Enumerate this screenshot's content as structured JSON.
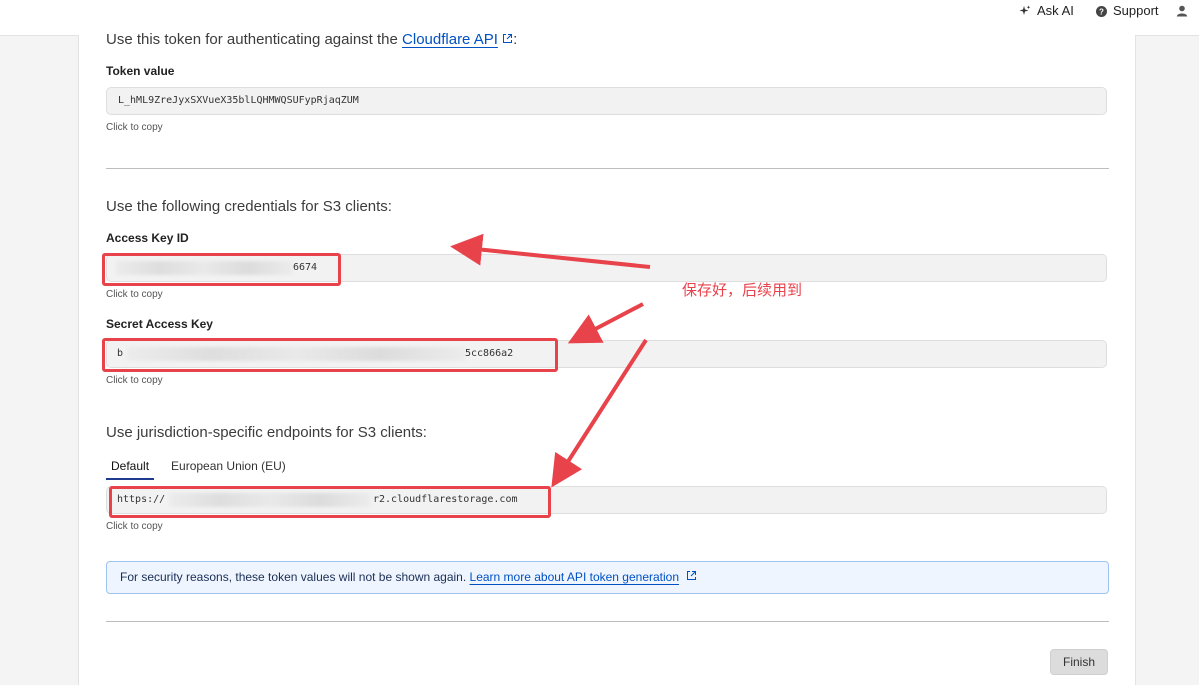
{
  "topbar": {
    "ask_ai_label": "Ask AI",
    "support_label": "Support"
  },
  "token_section": {
    "intro_text": "Use this token for authenticating against the",
    "api_link_text": "Cloudflare API",
    "intro_suffix": ":",
    "token_label": "Token value",
    "token_value": "L_hML9ZreJyxSXVueX35blLQHMWQSUFypRjaqZUM",
    "click_to_copy": "Click to copy"
  },
  "s3_section": {
    "intro_text": "Use the following credentials for S3 clients:",
    "access_key_label": "Access Key ID",
    "access_key_visible_suffix": "6674",
    "secret_key_label": "Secret Access Key",
    "secret_key_visible_prefix": "b",
    "secret_key_visible_suffix": "5cc866a2",
    "click_to_copy": "Click to copy"
  },
  "endpoint_section": {
    "intro_text": "Use jurisdiction-specific endpoints for S3 clients:",
    "tabs": [
      {
        "label": "Default",
        "active": true
      },
      {
        "label": "European Union (EU)",
        "active": false
      }
    ],
    "endpoint_prefix": "https://",
    "endpoint_suffix": "r2.cloudflarestorage.com",
    "click_to_copy": "Click to copy"
  },
  "notice": {
    "text": "For security reasons, these token values will not be shown again.",
    "link_text": "Learn more about API token generation"
  },
  "footer": {
    "finish_label": "Finish"
  },
  "annotation": {
    "text": "保存好，后续用到"
  },
  "colors": {
    "annotation_red": "#e8424b",
    "link_blue": "#0051c3",
    "notice_bg": "#eef5ff",
    "notice_border": "#9fc3f1"
  },
  "icons": [
    "sparkle-icon",
    "help-circle-icon",
    "user-icon",
    "external-link-icon"
  ]
}
